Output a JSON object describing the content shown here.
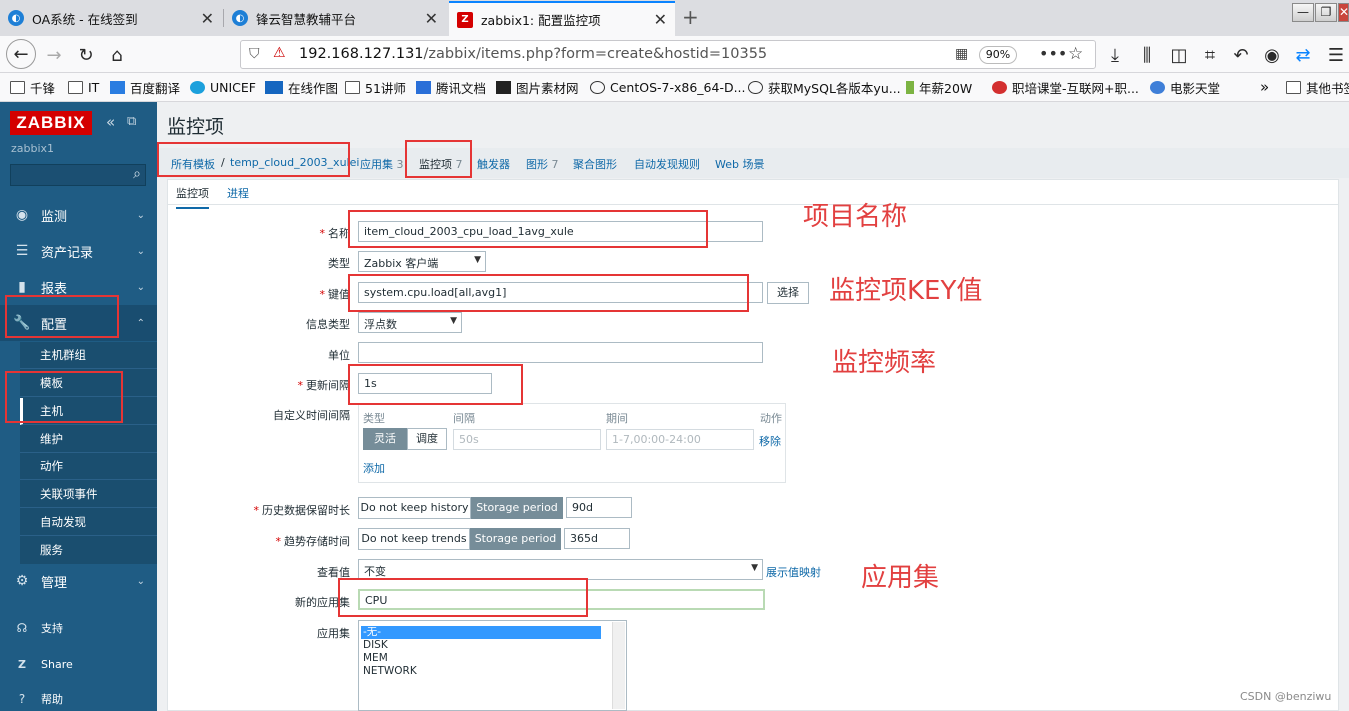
{
  "browser": {
    "tabs": [
      {
        "title": "OA系统 - 在线签到",
        "icon": "search-icon"
      },
      {
        "title": "锋云智慧教辅平台",
        "icon": "search-icon"
      },
      {
        "title": "zabbix1: 配置监控项",
        "icon": "zabbix-z-icon"
      }
    ],
    "new_tab": "+",
    "url_host": "192.168.127.131",
    "url_path": "/zabbix/items.php?form=create&hostid=10355",
    "zoom": "90%",
    "bookmarks": [
      "千锋",
      "IT",
      "百度翻译",
      "UNICEF",
      "在线作图",
      "51讲师",
      "腾讯文档",
      "图片素材网",
      "CentOS-7-x86_64-D...",
      "获取MySQL各版本yu...",
      "年薪20W",
      "职培课堂-互联网+职...",
      "电影天堂"
    ],
    "bookmark_more": "»",
    "other_bookmarks": "其他书签"
  },
  "sidebar": {
    "logo": "ZABBIX",
    "server": "zabbix1",
    "menu": [
      {
        "label": "监测",
        "icon": "eye-icon"
      },
      {
        "label": "资产记录",
        "icon": "list-icon"
      },
      {
        "label": "报表",
        "icon": "bar-chart-icon"
      },
      {
        "label": "配置",
        "icon": "wrench-icon"
      },
      {
        "label": "管理",
        "icon": "gear-icon"
      }
    ],
    "submenu": [
      "主机群组",
      "模板",
      "主机",
      "维护",
      "动作",
      "关联项事件",
      "自动发现",
      "服务"
    ],
    "footer": [
      {
        "label": "支持",
        "icon": "headset-icon"
      },
      {
        "label": "Share",
        "icon": "share-z-icon"
      },
      {
        "label": "帮助",
        "icon": "help-icon"
      }
    ]
  },
  "page": {
    "title": "监控项",
    "breadcrumb": {
      "all_templates": "所有模板",
      "separator": "/",
      "template": "temp_cloud_2003_xulei",
      "applications": "应用集",
      "applications_count": "3",
      "items": "监控项",
      "items_count": "7",
      "triggers": "触发器",
      "graphs": "图形",
      "graphs_count": "7",
      "screens": "聚合图形",
      "discovery": "自动发现规则",
      "web": "Web 场景"
    },
    "form_tabs": [
      "监控项",
      "进程"
    ],
    "form": {
      "name_label": "名称",
      "name_value": "item_cloud_2003_cpu_load_1avg_xule",
      "type_label": "类型",
      "type_value": "Zabbix 客户端",
      "key_label": "键值",
      "key_value": "system.cpu.load[all,avg1]",
      "select_button": "选择",
      "info_type_label": "信息类型",
      "info_type_value": "浮点数",
      "units_label": "单位",
      "units_value": "",
      "interval_label": "更新间隔",
      "interval_value": "1s",
      "custom_intervals_label": "自定义时间间隔",
      "ci_headers": {
        "type": "类型",
        "interval": "间隔",
        "period": "期间",
        "action": "动作"
      },
      "ci_flexible": "灵活",
      "ci_scheduling": "调度",
      "ci_interval_placeholder": "50s",
      "ci_period_placeholder": "1-7,00:00-24:00",
      "ci_remove": "移除",
      "ci_add": "添加",
      "history_label": "历史数据保留时长",
      "history_no_keep": "Do not keep history",
      "history_storage": "Storage period",
      "history_value": "90d",
      "trends_label": "趋势存储时间",
      "trends_no_keep": "Do not keep trends",
      "trends_storage": "Storage period",
      "trends_value": "365d",
      "valuemap_label": "查看值",
      "valuemap_value": "不变",
      "valuemap_link": "展示值映射",
      "new_app_label": "新的应用集",
      "new_app_value": "CPU",
      "apps_label": "应用集",
      "apps_options": [
        "-无-",
        "DISK",
        "MEM",
        "NETWORK"
      ]
    }
  },
  "annotations": [
    "项目名称",
    "监控项KEY值",
    "监控频率",
    "应用集"
  ],
  "watermark": "CSDN @benziwu",
  "colors": {
    "sidebar": "#1f5c84",
    "logo": "#d40000",
    "annotation": "#e24040",
    "link": "#0f69a8"
  }
}
